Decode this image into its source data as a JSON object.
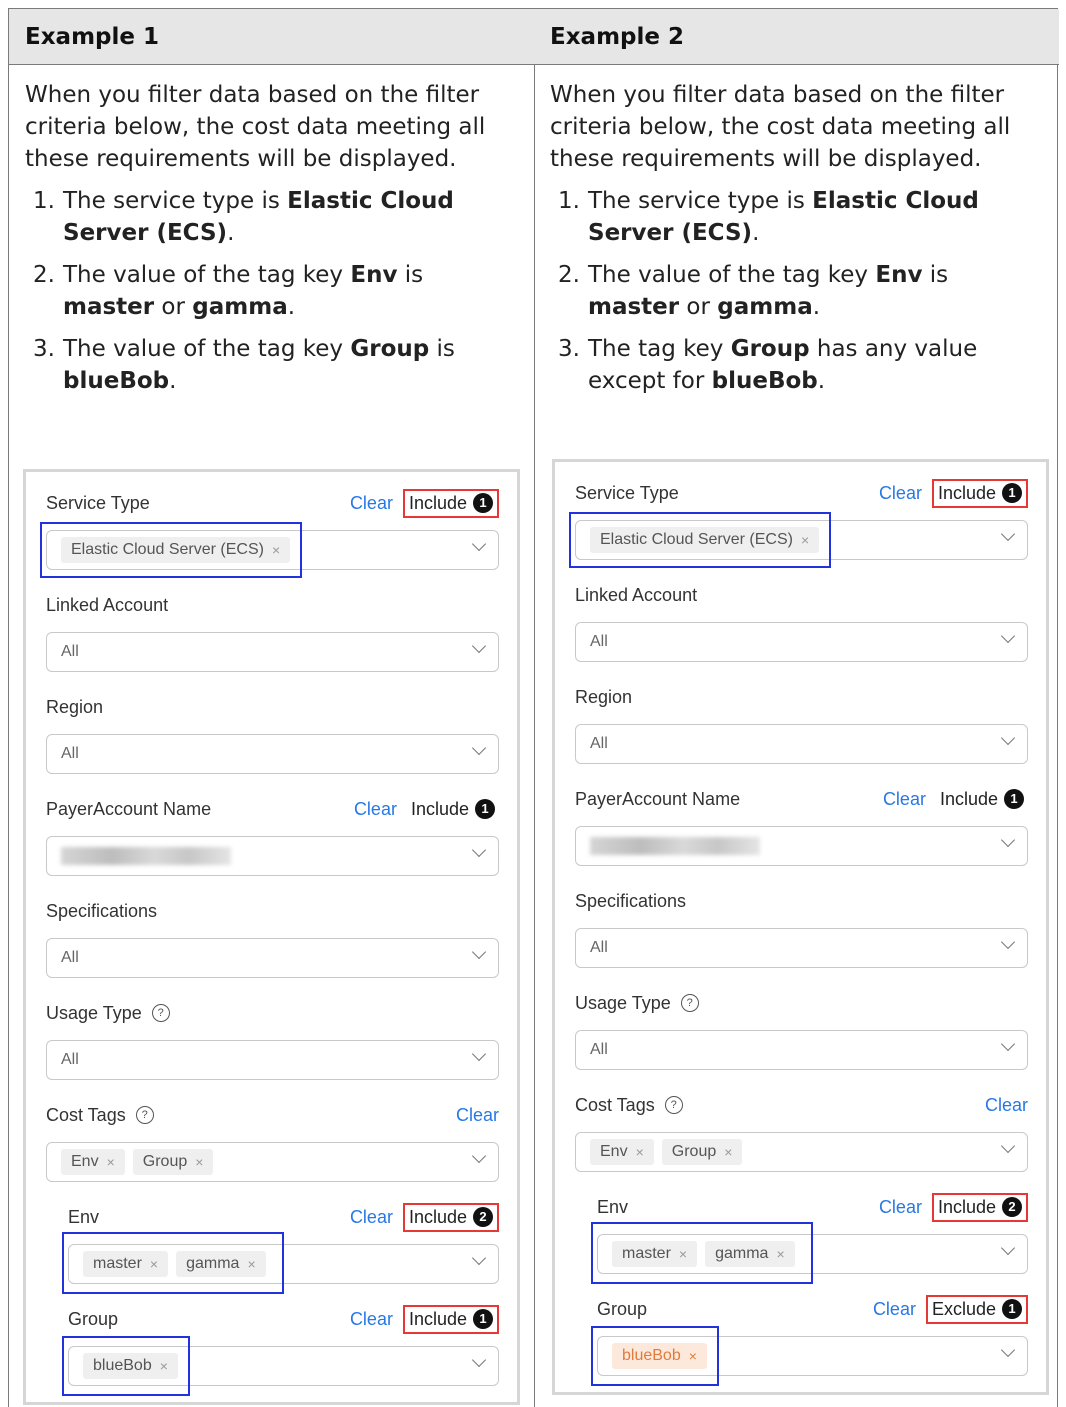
{
  "examples": [
    {
      "heading": "Example 1",
      "intro": "When you filter data based on the filter criteria below, the cost data meeting all these requirements will be displayed.",
      "requirements": [
        {
          "num": "1.",
          "parts": [
            "The service type is ",
            "Elastic Cloud Server (ECS)",
            "."
          ]
        },
        {
          "num": "2.",
          "parts": [
            "The value of the tag key ",
            "Env",
            " is ",
            "master",
            " or ",
            "gamma",
            "."
          ]
        },
        {
          "num": "3.",
          "parts": [
            "The value of the tag key ",
            "Group",
            " is ",
            "blueBob",
            "."
          ]
        }
      ],
      "panel": {
        "service_type": {
          "label": "Service Type",
          "clear": "Clear",
          "mode": "Include",
          "badge": "1",
          "chip": "Elastic Cloud Server (ECS)",
          "chip_x": "×"
        },
        "linked_account": {
          "label": "Linked Account",
          "value": "All"
        },
        "region": {
          "label": "Region",
          "value": "All"
        },
        "payer": {
          "label": "PayerAccount Name",
          "clear": "Clear",
          "mode": "Include",
          "badge": "1"
        },
        "specifications": {
          "label": "Specifications",
          "value": "All"
        },
        "usage_type": {
          "label": "Usage Type",
          "help": "?",
          "value": "All"
        },
        "cost_tags": {
          "label": "Cost Tags",
          "help": "?",
          "clear": "Clear",
          "chips": [
            "Env",
            "Group"
          ]
        },
        "env": {
          "label": "Env",
          "clear": "Clear",
          "mode": "Include",
          "badge": "2",
          "chips": [
            "master",
            "gamma"
          ]
        },
        "group": {
          "label": "Group",
          "clear": "Clear",
          "mode": "Include",
          "badge": "1",
          "chip": "blueBob"
        }
      }
    },
    {
      "heading": "Example 2",
      "intro": "When you filter data based on the filter criteria below, the cost data meeting all these requirements will be displayed.",
      "requirements": [
        {
          "num": "1.",
          "parts": [
            "The service type is ",
            "Elastic Cloud Server (ECS)",
            "."
          ]
        },
        {
          "num": "2.",
          "parts": [
            "The value of the tag key ",
            "Env",
            " is ",
            "master",
            " or ",
            "gamma",
            "."
          ]
        },
        {
          "num": "3.",
          "parts": [
            "The tag key ",
            "Group",
            " has any value except for ",
            "blueBob",
            "."
          ]
        }
      ],
      "panel": {
        "service_type": {
          "label": "Service Type",
          "clear": "Clear",
          "mode": "Include",
          "badge": "1",
          "chip": "Elastic Cloud Server (ECS)",
          "chip_x": "×"
        },
        "linked_account": {
          "label": "Linked Account",
          "value": "All"
        },
        "region": {
          "label": "Region",
          "value": "All"
        },
        "payer": {
          "label": "PayerAccount Name",
          "clear": "Clear",
          "mode": "Include",
          "badge": "1"
        },
        "specifications": {
          "label": "Specifications",
          "value": "All"
        },
        "usage_type": {
          "label": "Usage Type",
          "help": "?",
          "value": "All"
        },
        "cost_tags": {
          "label": "Cost Tags",
          "help": "?",
          "clear": "Clear",
          "chips": [
            "Env",
            "Group"
          ]
        },
        "env": {
          "label": "Env",
          "clear": "Clear",
          "mode": "Include",
          "badge": "2",
          "chips": [
            "master",
            "gamma"
          ]
        },
        "group": {
          "label": "Group",
          "clear": "Clear",
          "mode": "Exclude",
          "badge": "1",
          "chip": "blueBob"
        }
      }
    }
  ],
  "colors": {
    "highlight_red": "#e53935",
    "highlight_blue": "#2233dd",
    "link_blue": "#2778e5",
    "exclude_chip": "#e07b3c"
  }
}
